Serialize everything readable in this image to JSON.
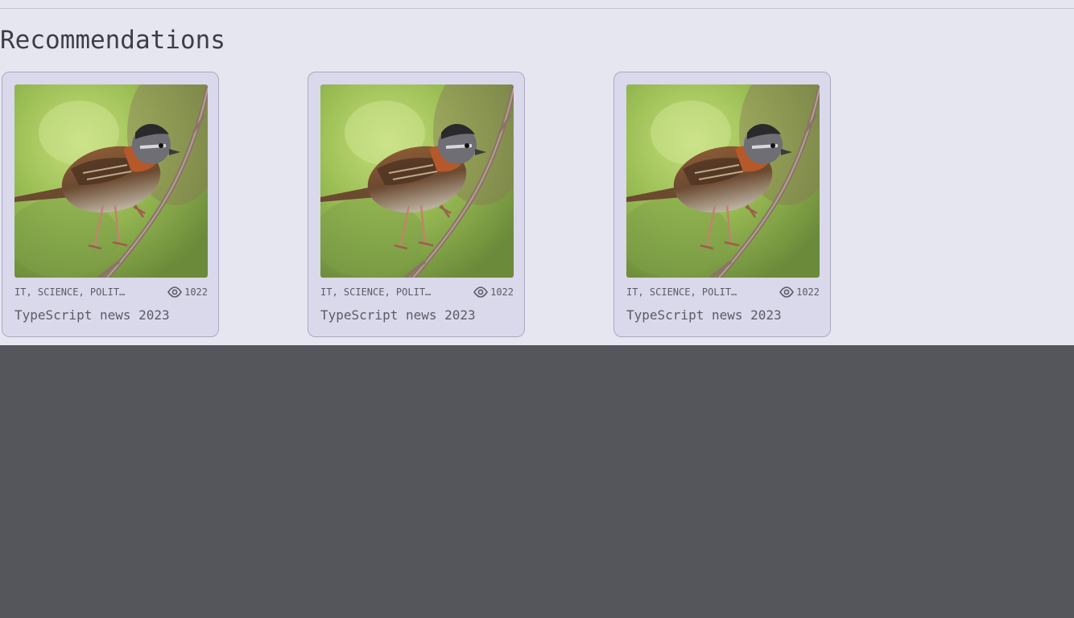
{
  "section": {
    "title": "Recommendations"
  },
  "cards": [
    {
      "tags": "IT, SCIENCE, POLITICS",
      "views": "1022",
      "title": "TypeScript news 2023",
      "image_icon": "bird-photo"
    },
    {
      "tags": "IT, SCIENCE, POLITICS",
      "views": "1022",
      "title": "TypeScript news 2023",
      "image_icon": "bird-photo"
    },
    {
      "tags": "IT, SCIENCE, POLITICS",
      "views": "1022",
      "title": "TypeScript news 2023",
      "image_icon": "bird-photo"
    }
  ],
  "colors": {
    "page_background": "#e6e6f1",
    "card_background": "#d9d9eb",
    "card_border": "#a9a9c0",
    "footer_background": "#55565c",
    "text": "#5b5b66"
  }
}
